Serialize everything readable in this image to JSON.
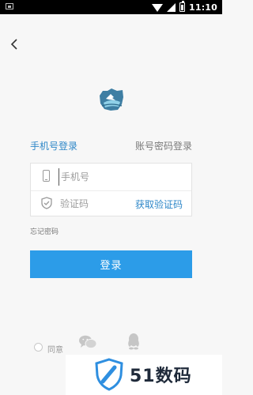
{
  "status_bar": {
    "time": "11:10"
  },
  "login": {
    "tabs": {
      "phone_login": "手机号登录",
      "account_login": "账号密码登录"
    },
    "phone_placeholder": "手机号",
    "code_placeholder": "验证码",
    "get_code": "获取验证码",
    "forgot_password": "忘记密码",
    "login_button": "登录",
    "agree_text": "同意"
  },
  "watermark": {
    "text": "51数码"
  },
  "colors": {
    "accent": "#2c9ce8",
    "link": "#2e87c8",
    "background": "#f7f7f7"
  }
}
